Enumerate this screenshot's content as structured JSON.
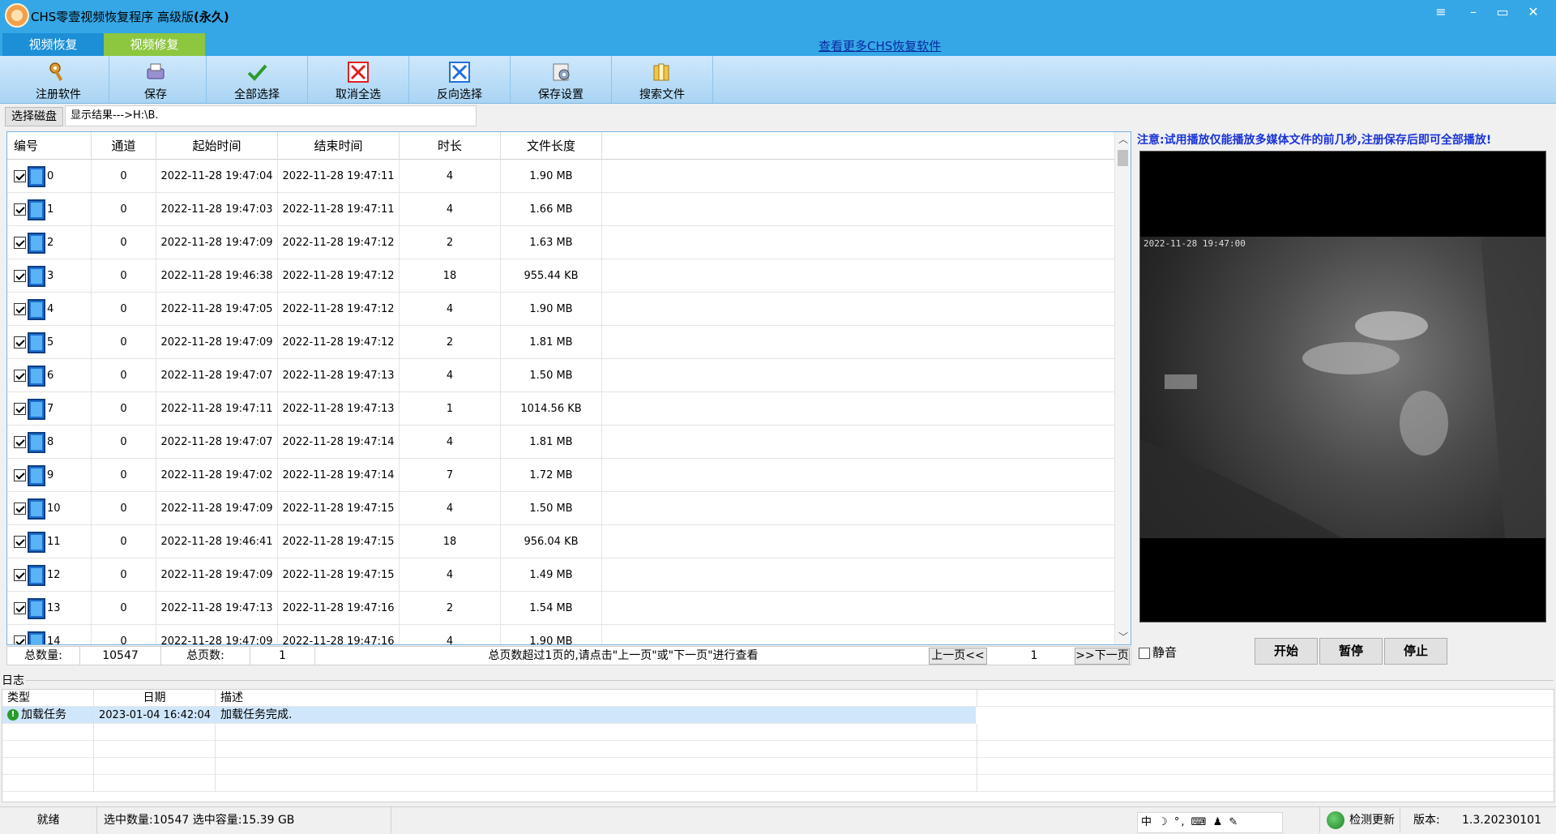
{
  "window": {
    "title_main": "CHS零壹视频恢复程序 高级版",
    "title_edition": "(永久)",
    "menu_icon": "≡",
    "min_icon": "–",
    "max_icon": "▭",
    "close_icon": "✕"
  },
  "tabs": [
    {
      "label": "视频恢复"
    },
    {
      "label": "视频修复"
    }
  ],
  "more_link": "查看更多CHS恢复软件",
  "toolbar": [
    {
      "label": "注册软件",
      "icon": "key-icon"
    },
    {
      "label": "保存",
      "icon": "save-icon"
    },
    {
      "label": "全部选择",
      "icon": "check-icon"
    },
    {
      "label": "取消全选",
      "icon": "cancel-icon"
    },
    {
      "label": "反向选择",
      "icon": "invert-icon"
    },
    {
      "label": "保存设置",
      "icon": "settings-icon"
    },
    {
      "label": "搜索文件",
      "icon": "folder-icon"
    }
  ],
  "disk": {
    "button_label": "选择磁盘",
    "path_text": "显示结果--->H:\\B."
  },
  "grid": {
    "columns": [
      "编号",
      "通道",
      "起始时间",
      "结束时间",
      "时长",
      "文件长度"
    ],
    "rows": [
      {
        "id": "0",
        "channel": "0",
        "start": "2022-11-28 19:47:04",
        "end": "2022-11-28 19:47:11",
        "duration": "4",
        "size": "1.90 MB"
      },
      {
        "id": "1",
        "channel": "0",
        "start": "2022-11-28 19:47:03",
        "end": "2022-11-28 19:47:11",
        "duration": "4",
        "size": "1.66 MB"
      },
      {
        "id": "2",
        "channel": "0",
        "start": "2022-11-28 19:47:09",
        "end": "2022-11-28 19:47:12",
        "duration": "2",
        "size": "1.63 MB"
      },
      {
        "id": "3",
        "channel": "0",
        "start": "2022-11-28 19:46:38",
        "end": "2022-11-28 19:47:12",
        "duration": "18",
        "size": "955.44 KB"
      },
      {
        "id": "4",
        "channel": "0",
        "start": "2022-11-28 19:47:05",
        "end": "2022-11-28 19:47:12",
        "duration": "4",
        "size": "1.90 MB"
      },
      {
        "id": "5",
        "channel": "0",
        "start": "2022-11-28 19:47:09",
        "end": "2022-11-28 19:47:12",
        "duration": "2",
        "size": "1.81 MB"
      },
      {
        "id": "6",
        "channel": "0",
        "start": "2022-11-28 19:47:07",
        "end": "2022-11-28 19:47:13",
        "duration": "4",
        "size": "1.50 MB"
      },
      {
        "id": "7",
        "channel": "0",
        "start": "2022-11-28 19:47:11",
        "end": "2022-11-28 19:47:13",
        "duration": "1",
        "size": "1014.56 KB"
      },
      {
        "id": "8",
        "channel": "0",
        "start": "2022-11-28 19:47:07",
        "end": "2022-11-28 19:47:14",
        "duration": "4",
        "size": "1.81 MB"
      },
      {
        "id": "9",
        "channel": "0",
        "start": "2022-11-28 19:47:02",
        "end": "2022-11-28 19:47:14",
        "duration": "7",
        "size": "1.72 MB"
      },
      {
        "id": "10",
        "channel": "0",
        "start": "2022-11-28 19:47:09",
        "end": "2022-11-28 19:47:15",
        "duration": "4",
        "size": "1.50 MB"
      },
      {
        "id": "11",
        "channel": "0",
        "start": "2022-11-28 19:46:41",
        "end": "2022-11-28 19:47:15",
        "duration": "18",
        "size": "956.04 KB"
      },
      {
        "id": "12",
        "channel": "0",
        "start": "2022-11-28 19:47:09",
        "end": "2022-11-28 19:47:15",
        "duration": "4",
        "size": "1.49 MB"
      },
      {
        "id": "13",
        "channel": "0",
        "start": "2022-11-28 19:47:13",
        "end": "2022-11-28 19:47:16",
        "duration": "2",
        "size": "1.54 MB"
      },
      {
        "id": "14",
        "channel": "0",
        "start": "2022-11-28 19:47:09",
        "end": "2022-11-28 19:47:16",
        "duration": "4",
        "size": "1.90 MB"
      }
    ]
  },
  "summary": {
    "total_label": "总数量:",
    "total_value": "10547",
    "pages_label": "总页数:",
    "pages_value": "1",
    "hint": "总页数超过1页的,请点击\"上一页\"或\"下一页\"进行查看",
    "prev_label": "上一页<<",
    "page_input": "1",
    "next_label": ">>下一页"
  },
  "preview": {
    "notice": "注意:试用播放仅能播放多媒体文件的前几秒,注册保存后即可全部播放!",
    "video_timestamp": "2022-11-28 19:47:00",
    "mute_label": "静音",
    "start_label": "开始",
    "pause_label": "暂停",
    "stop_label": "停止"
  },
  "log": {
    "title": "日志",
    "columns": [
      "类型",
      "日期",
      "描述"
    ],
    "rows": [
      {
        "type": "加载任务",
        "date": "2023-01-04 16:42:04",
        "desc": "加载任务完成."
      }
    ]
  },
  "status": {
    "ready": "就绪",
    "selection": "选中数量:10547 选中容量:15.39 GB",
    "ime": "中 ☽ °, ⌨ ♟ ✎",
    "update_label": "检测更新",
    "version_label": "版本:",
    "version_value": "1.3.20230101"
  }
}
